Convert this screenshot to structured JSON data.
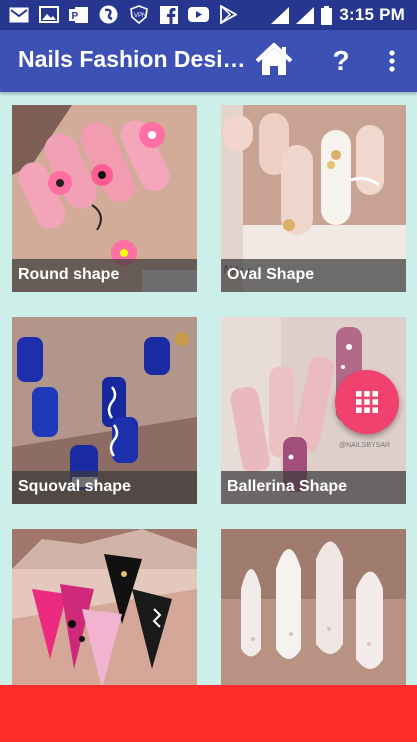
{
  "status_bar": {
    "time": "3:15 PM",
    "icons": [
      "gmail-icon",
      "image-icon",
      "publisher-icon",
      "browser-icon",
      "shield-icon",
      "facebook-icon",
      "youtube-icon",
      "play-store-icon"
    ],
    "right_icons": [
      "signal-icon",
      "signal-icon",
      "battery-icon"
    ]
  },
  "app_bar": {
    "title": "Nails Fashion Desi…",
    "actions": [
      "home-icon",
      "help-icon",
      "more-vert-icon"
    ],
    "help_label": "?"
  },
  "cards": [
    {
      "label": "Round shape"
    },
    {
      "label": "Oval Shape"
    },
    {
      "label": "Squoval shape"
    },
    {
      "label": "Ballerina Shape"
    },
    {
      "label": ""
    },
    {
      "label": ""
    }
  ],
  "fab": {
    "icon": "grid-icon"
  },
  "colors": {
    "status_bar": "#27378f",
    "app_bar": "#3d51b4",
    "background": "#cdefe9",
    "fab": "#f1416f",
    "ad_bar": "#ff2a2a"
  }
}
